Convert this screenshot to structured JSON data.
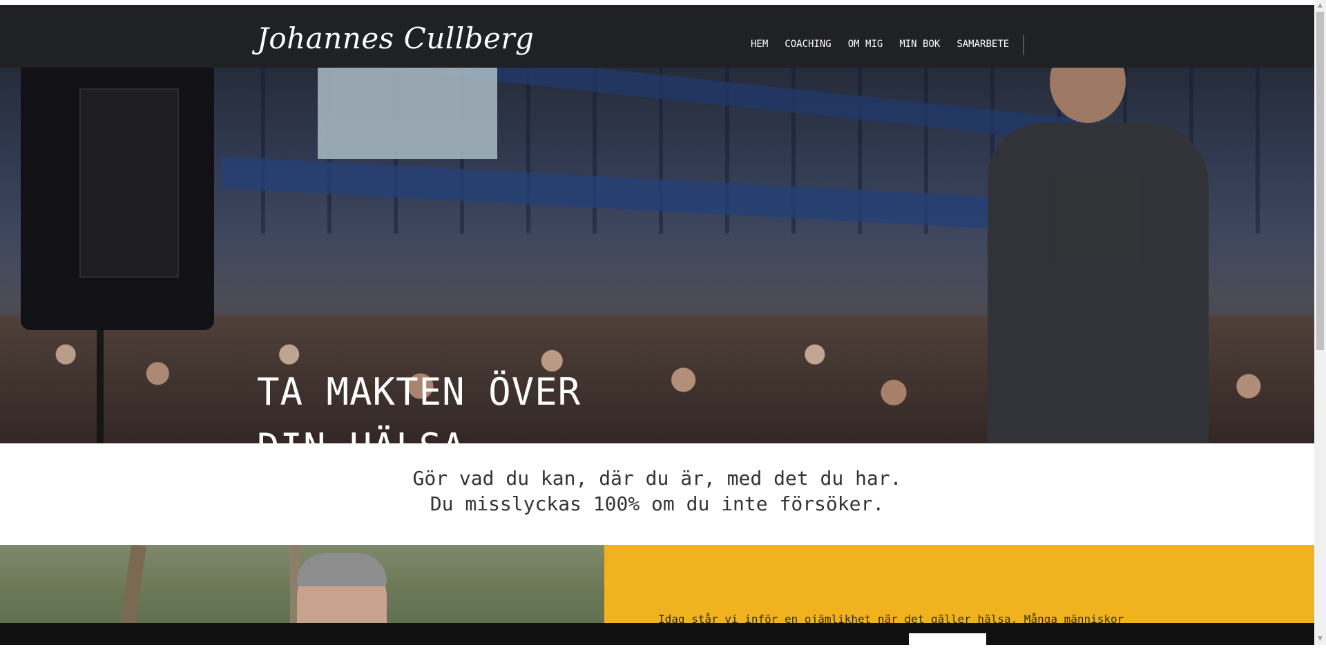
{
  "header": {
    "logo_text": "Johannes Cullberg",
    "nav": [
      {
        "label": "HEM"
      },
      {
        "label": "COACHING"
      },
      {
        "label": "OM MIG"
      },
      {
        "label": "MIN BOK"
      },
      {
        "label": "SAMARBETE"
      }
    ]
  },
  "hero": {
    "title_line1": "TA MAKTEN ÖVER",
    "title_line2": "DIN HÄLSA"
  },
  "quote": {
    "line1": "Gör vad du kan, där du är, med det du har.",
    "line2": "Du misslyckas 100% om du inte försöker."
  },
  "intro": {
    "text": "Idag står vi inför en ojämlikhet när det gäller hälsa. Många människor"
  },
  "colors": {
    "header_bg": "#202124",
    "accent_yellow": "#f0b21e",
    "cookie_bg": "#111111"
  },
  "icons": {
    "scroll_up": "▲",
    "scroll_down": "▼"
  }
}
